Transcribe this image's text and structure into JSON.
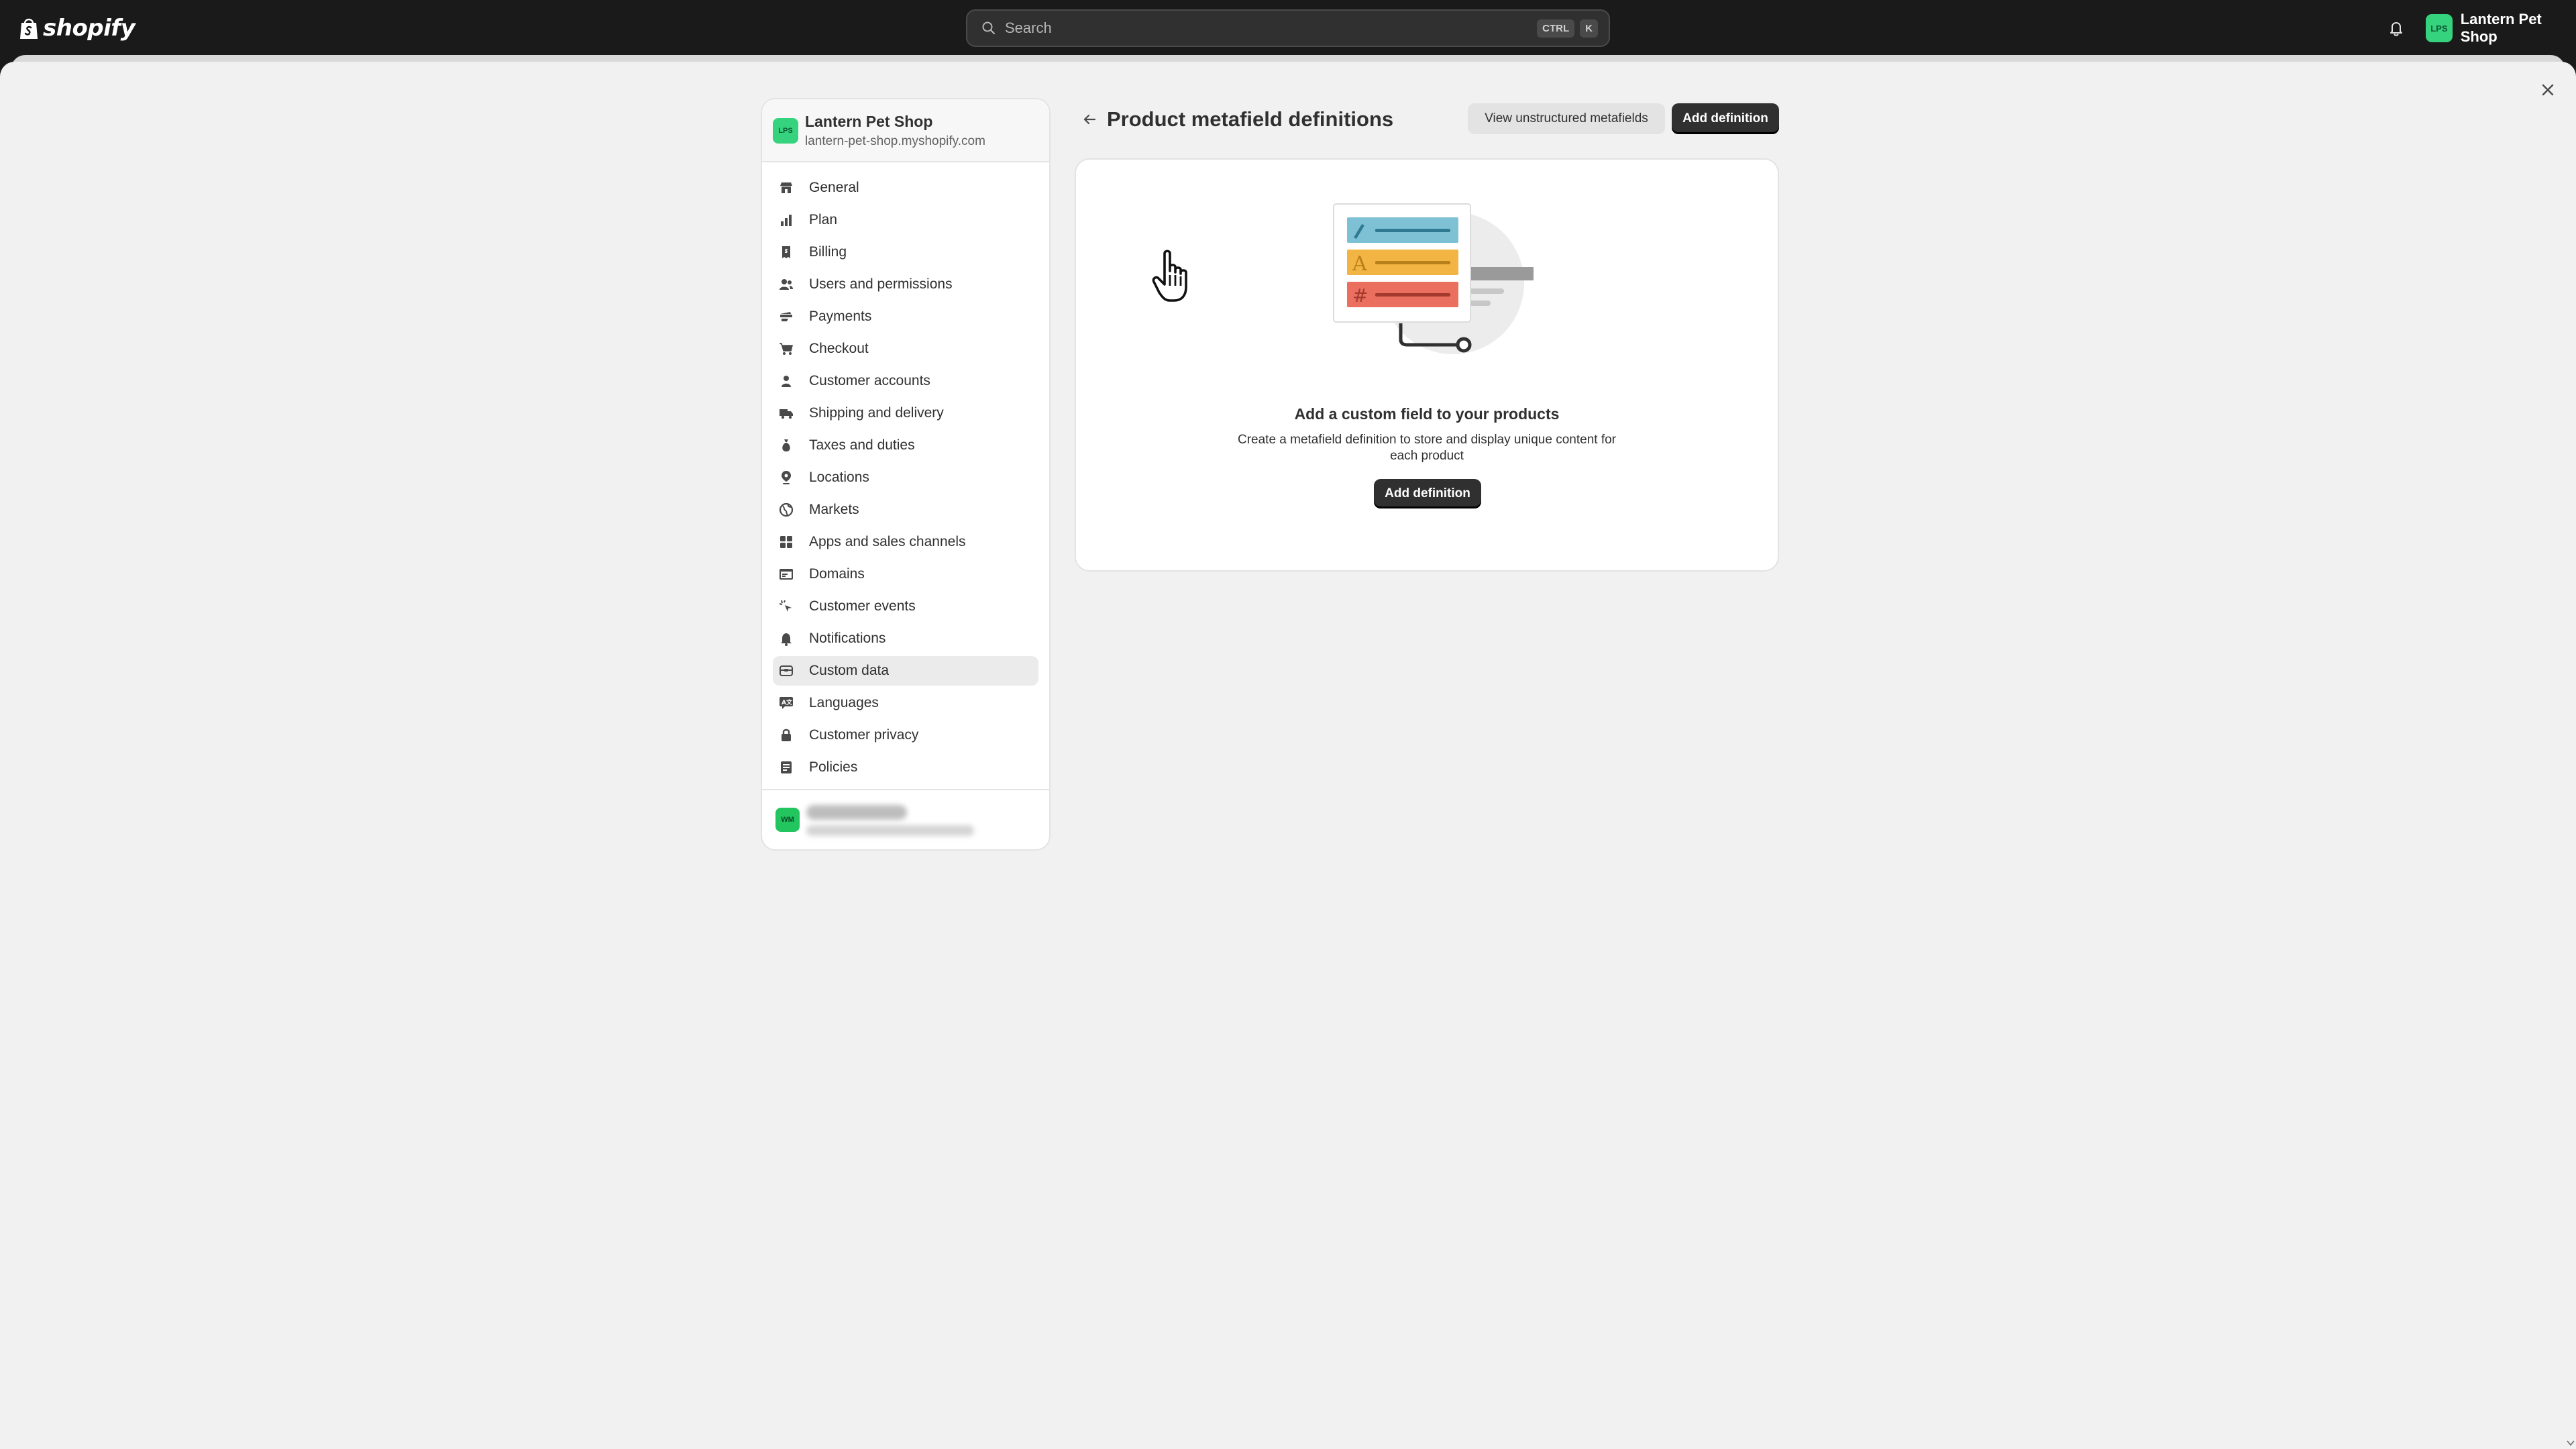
{
  "topbar": {
    "logo_text": "shopify",
    "search_placeholder": "Search",
    "shortcut_keys": [
      "CTRL",
      "K"
    ],
    "store_initials": "LPS",
    "store_name": "Lantern Pet Shop"
  },
  "sidebar": {
    "store_initials": "LPS",
    "store_name": "Lantern Pet Shop",
    "store_url": "lantern-pet-shop.myshopify.com",
    "items": [
      {
        "label": "General",
        "icon": "store-icon"
      },
      {
        "label": "Plan",
        "icon": "plan-chart-icon"
      },
      {
        "label": "Billing",
        "icon": "receipt-icon"
      },
      {
        "label": "Users and permissions",
        "icon": "users-icon"
      },
      {
        "label": "Payments",
        "icon": "payments-icon"
      },
      {
        "label": "Checkout",
        "icon": "cart-icon"
      },
      {
        "label": "Customer accounts",
        "icon": "person-icon"
      },
      {
        "label": "Shipping and delivery",
        "icon": "truck-icon"
      },
      {
        "label": "Taxes and duties",
        "icon": "tax-bag-icon"
      },
      {
        "label": "Locations",
        "icon": "location-pin-icon"
      },
      {
        "label": "Markets",
        "icon": "globe-icon"
      },
      {
        "label": "Apps and sales channels",
        "icon": "apps-icon"
      },
      {
        "label": "Domains",
        "icon": "domains-icon"
      },
      {
        "label": "Customer events",
        "icon": "cursor-events-icon"
      },
      {
        "label": "Notifications",
        "icon": "bell-icon"
      },
      {
        "label": "Custom data",
        "icon": "database-icon"
      },
      {
        "label": "Languages",
        "icon": "languages-icon"
      },
      {
        "label": "Customer privacy",
        "icon": "lock-icon"
      },
      {
        "label": "Policies",
        "icon": "policies-icon"
      }
    ],
    "active_item": "Custom data",
    "user_initials": "WM"
  },
  "page": {
    "title": "Product metafield definitions",
    "secondary_action": "View unstructured metafields",
    "primary_action": "Add definition"
  },
  "empty_state": {
    "heading": "Add a custom field to your products",
    "description": "Create a metafield definition to store and display unique content for each product",
    "action": "Add definition"
  },
  "colors": {
    "topbar_bg": "#1a1a1a",
    "canvas_bg": "#f1f1f1",
    "primary_button": "#303030",
    "avatar_green": "#36d37e",
    "illustration_blue": "#7ec1d4",
    "illustration_orange": "#f2b544",
    "illustration_red": "#ea6f5e"
  }
}
